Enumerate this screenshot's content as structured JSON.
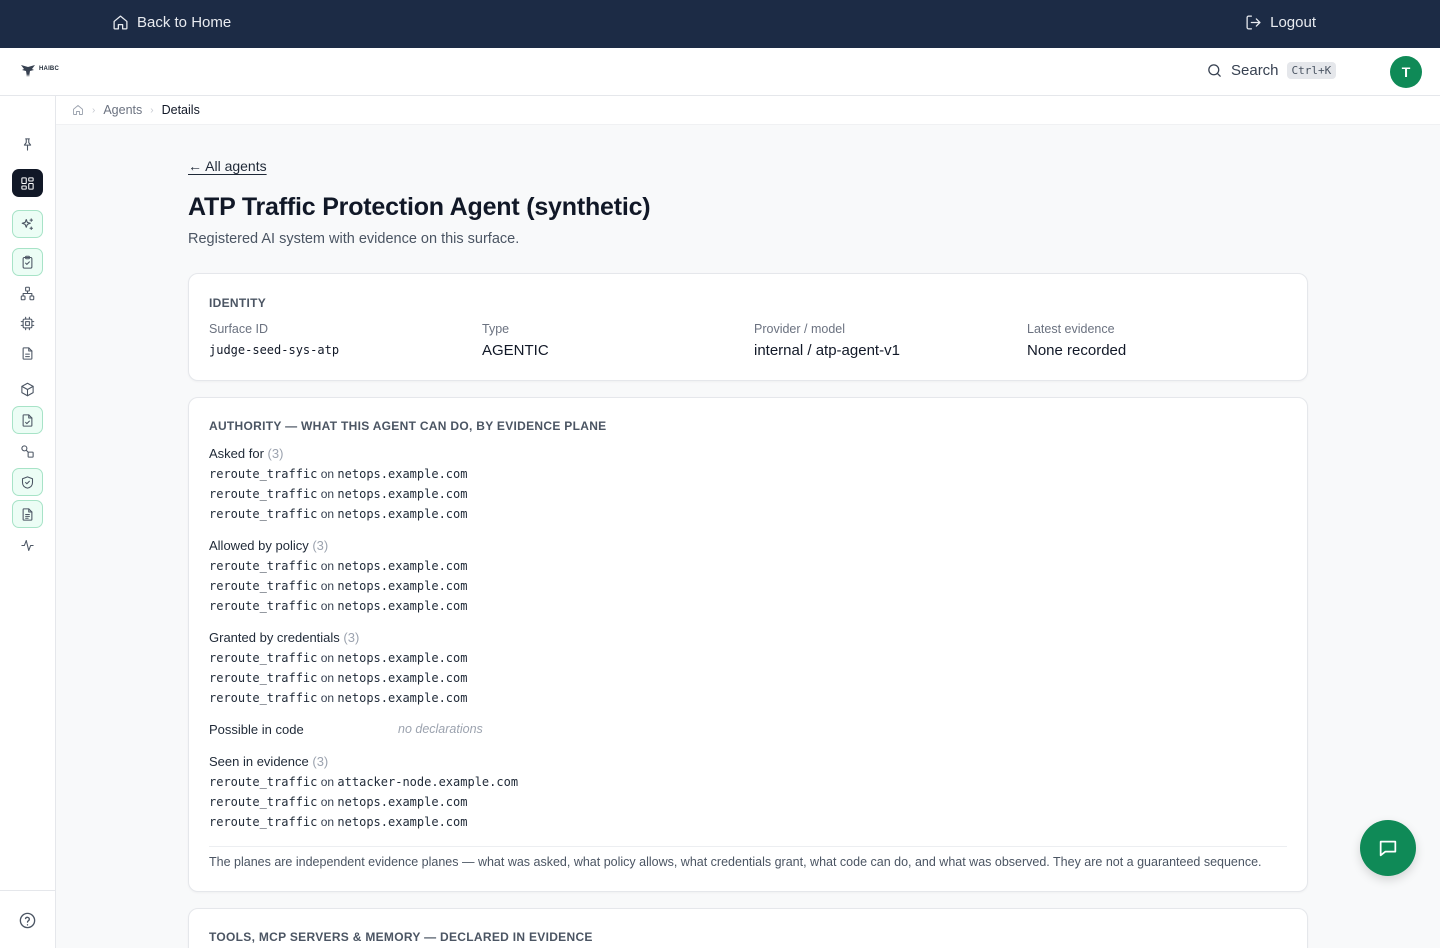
{
  "topbar": {
    "back_label": "Back to Home",
    "logout_label": "Logout"
  },
  "header": {
    "logo_text": "HAIBC",
    "search_label": "Search",
    "search_shortcut": "Ctrl+K",
    "avatar_initial": "T"
  },
  "breadcrumb": {
    "items": [
      "Agents",
      "Details"
    ]
  },
  "sidebar": {
    "icons": [
      "pin-icon",
      "dashboard-icon",
      "sparkles-icon",
      "clipboard-check-icon",
      "network-icon",
      "cpu-icon",
      "document-icon",
      "package-icon",
      "file-check-icon",
      "shapes-icon",
      "shield-check-icon",
      "file-text-icon",
      "activity-icon",
      "help-icon"
    ]
  },
  "page": {
    "back_link": "← All agents",
    "title": "ATP Traffic Protection Agent (synthetic)",
    "subtitle": "Registered AI system with evidence on this surface."
  },
  "identity": {
    "heading": "IDENTITY",
    "fields": [
      {
        "label": "Surface ID",
        "value": "judge-seed-sys-atp"
      },
      {
        "label": "Type",
        "value": "AGENTIC"
      },
      {
        "label": "Provider / model",
        "value": "internal / atp-agent-v1"
      },
      {
        "label": "Latest evidence",
        "value": "None recorded"
      }
    ]
  },
  "authority": {
    "heading": "AUTHORITY — WHAT THIS AGENT CAN DO, BY EVIDENCE PLANE",
    "connector": "on",
    "planes": [
      {
        "label": "Asked for",
        "count": "(3)",
        "rows": [
          {
            "action": "reroute_traffic",
            "target": "netops.example.com"
          },
          {
            "action": "reroute_traffic",
            "target": "netops.example.com"
          },
          {
            "action": "reroute_traffic",
            "target": "netops.example.com"
          }
        ]
      },
      {
        "label": "Allowed by policy",
        "count": "(3)",
        "rows": [
          {
            "action": "reroute_traffic",
            "target": "netops.example.com"
          },
          {
            "action": "reroute_traffic",
            "target": "netops.example.com"
          },
          {
            "action": "reroute_traffic",
            "target": "netops.example.com"
          }
        ]
      },
      {
        "label": "Granted by credentials",
        "count": "(3)",
        "rows": [
          {
            "action": "reroute_traffic",
            "target": "netops.example.com"
          },
          {
            "action": "reroute_traffic",
            "target": "netops.example.com"
          },
          {
            "action": "reroute_traffic",
            "target": "netops.example.com"
          }
        ]
      },
      {
        "label": "Possible in code",
        "empty": "no declarations"
      },
      {
        "label": "Seen in evidence",
        "count": "(3)",
        "rows": [
          {
            "action": "reroute_traffic",
            "target": "attacker-node.example.com"
          },
          {
            "action": "reroute_traffic",
            "target": "netops.example.com"
          },
          {
            "action": "reroute_traffic",
            "target": "netops.example.com"
          }
        ]
      }
    ],
    "note": "The planes are independent evidence planes — what was asked, what policy allows, what credentials grant, what code can do, and what was observed. They are not a guaranteed sequence."
  },
  "tools": {
    "heading": "TOOLS, MCP SERVERS & MEMORY — DECLARED IN EVIDENCE"
  },
  "colors": {
    "topbar": "#1c2b45",
    "accent": "#0f8a57",
    "active_nav": "#111827"
  }
}
